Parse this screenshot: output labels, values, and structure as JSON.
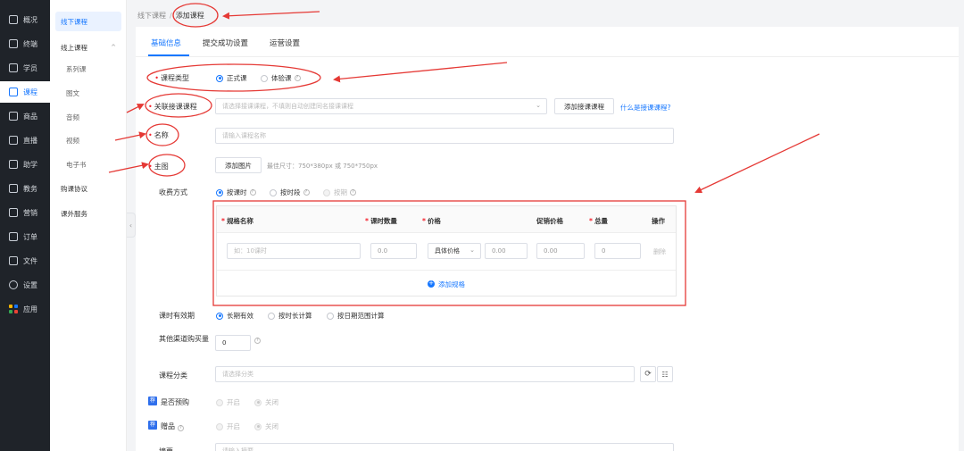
{
  "rail": {
    "items": [
      {
        "label": "概况",
        "icon": "overview-icon"
      },
      {
        "label": "终端",
        "icon": "terminal-icon"
      },
      {
        "label": "学员",
        "icon": "students-icon"
      },
      {
        "label": "课程",
        "icon": "course-icon",
        "active": true
      },
      {
        "label": "商品",
        "icon": "goods-icon"
      },
      {
        "label": "直播",
        "icon": "live-icon"
      },
      {
        "label": "助学",
        "icon": "assist-icon"
      },
      {
        "label": "教务",
        "icon": "academic-icon"
      },
      {
        "label": "营销",
        "icon": "marketing-icon"
      },
      {
        "label": "订单",
        "icon": "order-icon"
      },
      {
        "label": "文件",
        "icon": "folder-icon"
      },
      {
        "label": "设置",
        "icon": "gear-icon"
      },
      {
        "label": "应用",
        "icon": "apps-icon"
      }
    ]
  },
  "submenu": {
    "items": [
      {
        "label": "线下课程",
        "active": true
      },
      {
        "label": "线上课程",
        "group": true
      },
      {
        "label": "系列课",
        "child": true
      },
      {
        "label": "图文",
        "child": true
      },
      {
        "label": "音频",
        "child": true
      },
      {
        "label": "视频",
        "child": true
      },
      {
        "label": "电子书",
        "child": true
      },
      {
        "label": "购课协议"
      },
      {
        "label": "课外服务"
      }
    ],
    "collapse_glyph": "‹",
    "group_caret": "^"
  },
  "breadcrumb": {
    "parent": "线下课程",
    "separator": "/",
    "current": "添加课程"
  },
  "tabs": [
    {
      "label": "基础信息",
      "active": true
    },
    {
      "label": "提交成功设置"
    },
    {
      "label": "运营设置"
    }
  ],
  "form": {
    "course_type": {
      "label": "课程类型",
      "options": [
        "正式课",
        "体验课"
      ],
      "selected": "正式课"
    },
    "related_course": {
      "label": "关联接课课程",
      "placeholder": "请选择接课课程，不填则自动创建同名接课课程",
      "add_button": "添加接课课程",
      "help_link": "什么是接课课程?"
    },
    "name": {
      "label": "名称",
      "placeholder": "请输入课程名称"
    },
    "cover": {
      "label": "主图",
      "button": "添加图片",
      "hint": "最佳尺寸：750*380px 或 750*750px"
    },
    "charge_mode": {
      "label": "收费方式",
      "options": [
        "按课时",
        "按时段",
        "按期"
      ],
      "selected": "按课时"
    },
    "spec_table": {
      "headers": [
        "规格名称",
        "课时数量",
        "价格",
        "促销价格",
        "总量",
        "操作"
      ],
      "required": [
        true,
        true,
        true,
        false,
        true,
        false
      ],
      "row": {
        "name_placeholder": "如：10课时",
        "hours": "0.0",
        "price_type": "具体价格",
        "price": "0.00",
        "promo_price": "0.00",
        "total": "0",
        "action": "删除"
      },
      "add_label": "添加规格"
    },
    "validity": {
      "label": "课时有效期",
      "options": [
        "长期有效",
        "按时长计算",
        "按日期范围计算"
      ],
      "selected": "长期有效"
    },
    "other_channel": {
      "label": "其他渠道购买量",
      "value": "0"
    },
    "category": {
      "label": "课程分类",
      "placeholder": "请选择分类"
    },
    "presale": {
      "badge": "荐",
      "label": "是否预购",
      "options": [
        "开启",
        "关闭"
      ],
      "selected": "关闭"
    },
    "gift": {
      "badge": "荐",
      "label": "赠品",
      "options": [
        "开启",
        "关闭"
      ],
      "selected": "关闭"
    },
    "last_row": {
      "label": "摘要",
      "placeholder": "请输入摘要"
    }
  },
  "colors": {
    "accent": "#1677ff",
    "rail_bg": "#1f2329",
    "annotation": "#e53935"
  }
}
